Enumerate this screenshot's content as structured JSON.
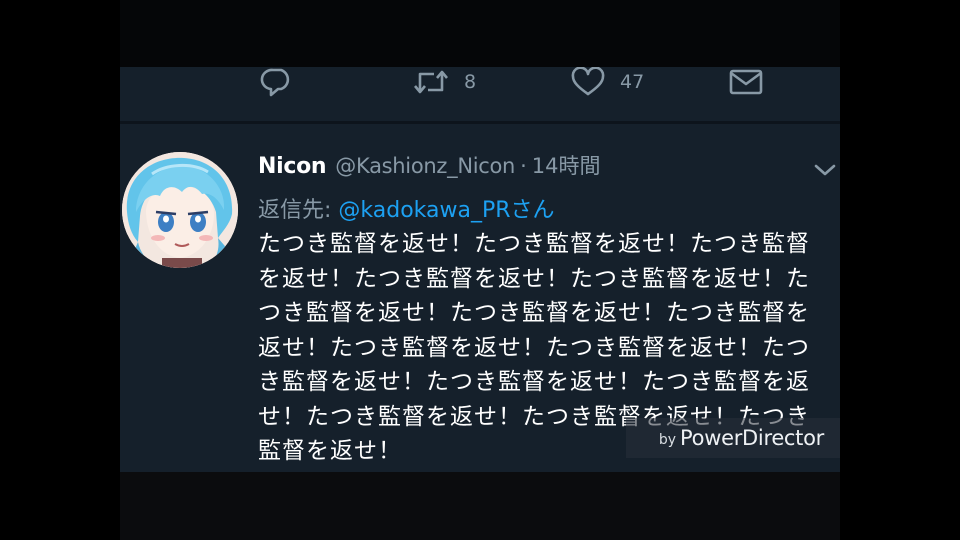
{
  "previous_tweet_actions": {
    "reply": {
      "icon": "reply-icon"
    },
    "retweet": {
      "icon": "retweet-icon",
      "count": "8"
    },
    "like": {
      "icon": "heart-icon",
      "count": "47"
    },
    "direct_message": {
      "icon": "envelope-icon"
    }
  },
  "tweet": {
    "display_name": "Nicon",
    "handle": "@Kashionz_Nicon",
    "separator": "·",
    "time": "14時間",
    "reply_label": "返信先: ",
    "reply_to": "@kadokawa_PRさん",
    "text": "たつき監督を返せ！たつき監督を返せ！たつき監督を返せ！たつき監督を返せ！たつき監督を返せ！たつき監督を返せ！たつき監督を返せ！たつき監督を返せ！たつき監督を返せ！たつき監督を返せ！たつき監督を返せ！たつき監督を返せ！たつき監督を返せ！たつき監督を返せ！たつき監督を返せ！たつき監督を返せ！",
    "menu_icon": "chevron-down-icon",
    "avatar_icon": "avatar"
  },
  "watermark": {
    "by": "by",
    "name": "PowerDirector"
  },
  "colors": {
    "background": "#15202b",
    "primary_text": "#ffffff",
    "secondary_text": "#8899a6",
    "link": "#1da1f2",
    "letterbox": "#000000"
  }
}
